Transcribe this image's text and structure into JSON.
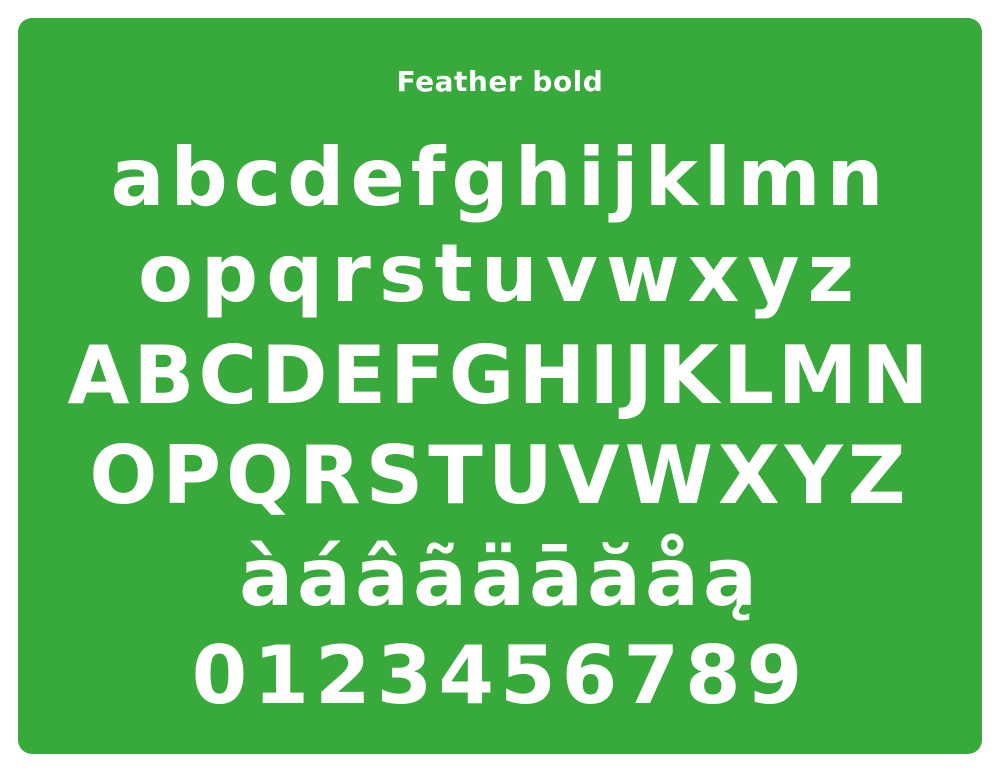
{
  "specimen": {
    "title": "Feather bold",
    "background_color": "#38a93b",
    "text_color": "#ffffff",
    "rows": [
      "abcdefghijklmn",
      "opqrstuvwxyz",
      "ABCDEFGHIJKLMN",
      "OPQRSTUVWXYZ",
      "àáâãäāăåą",
      "0123456789"
    ]
  }
}
